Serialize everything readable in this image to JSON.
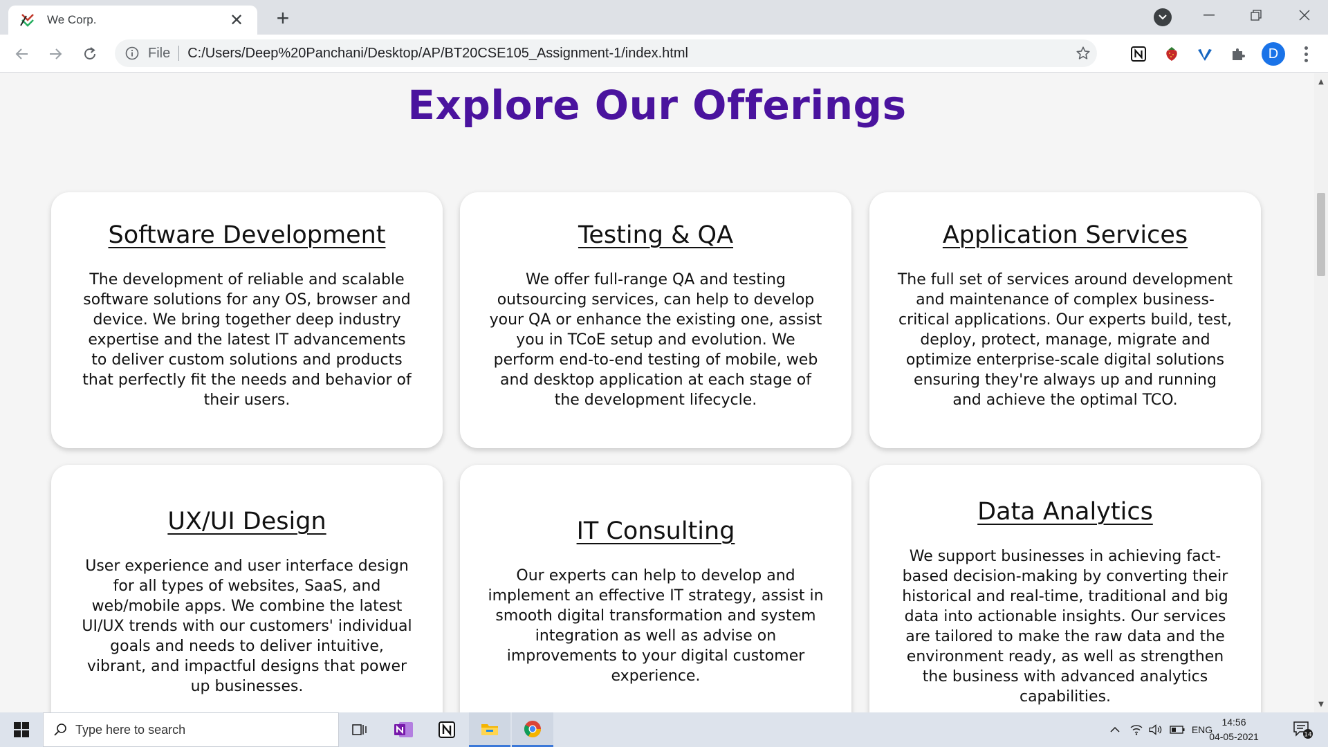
{
  "browser": {
    "tab_title": "We Corp.",
    "tab_close": "✕",
    "new_tab": "+",
    "omnibox_scheme": "File",
    "omnibox_url": "C:/Users/Deep%20Panchani/Desktop/AP/BT20CSE105_Assignment-1/index.html",
    "profile_initial": "D"
  },
  "page": {
    "section_title": "Explore Our Offerings",
    "cards": [
      {
        "title": "Software Development",
        "text": "The development of reliable and scalable software solutions for any OS, browser and device. We bring together deep industry expertise and the latest IT advancements to deliver custom solutions and products that perfectly fit the needs and behavior of their users."
      },
      {
        "title": "Testing & QA",
        "text": "We offer full-range QA and testing outsourcing services, can help to develop your QA or enhance the existing one, assist you in TCoE setup and evolution. We perform end-to-end testing of mobile, web and desktop application at each stage of the development lifecycle."
      },
      {
        "title": "Application Services",
        "text": "The full set of services around development and maintenance of complex business-critical applications. Our experts build, test, deploy, protect, manage, migrate and optimize enterprise-scale digital solutions ensuring they're always up and running and achieve the optimal TCO."
      },
      {
        "title": "UX/UI Design",
        "text": "User experience and user interface design for all types of websites, SaaS, and web/mobile apps. We combine the latest UI/UX trends with our customers' individual goals and needs to deliver intuitive, vibrant, and impactful designs that power up businesses."
      },
      {
        "title": "IT Consulting",
        "text": "Our experts can help to develop and implement an effective IT strategy, assist in smooth digital transformation and system integration as well as advise on improvements to your digital customer experience."
      },
      {
        "title": "Data Analytics",
        "text": "We support businesses in achieving fact-based decision-making by converting their historical and real-time, traditional and big data into actionable insights. Our services are tailored to make the raw data and the environment ready, as well as strengthen the business with advanced analytics capabilities."
      }
    ]
  },
  "taskbar": {
    "search_placeholder": "Type here to search",
    "language": "ENG",
    "time": "14:56",
    "date": "04-05-2021",
    "notification_count": "14"
  },
  "colors": {
    "title_purple": "#4a139e",
    "card_bg": "#ffffff",
    "page_bg": "#f5f5f5",
    "profile_blue": "#1a73e8"
  },
  "icons": [
    "we-corp-favicon",
    "back-arrow-icon",
    "forward-arrow-icon",
    "reload-icon",
    "info-icon",
    "bookmark-star-icon",
    "notion-extension-icon",
    "strawberry-extension-icon",
    "vimeo-extension-icon",
    "puzzle-extensions-icon",
    "windows-start-icon",
    "search-icon",
    "task-view-icon",
    "onenote-icon",
    "notion-icon",
    "file-explorer-icon",
    "chrome-icon",
    "notification-icon"
  ]
}
